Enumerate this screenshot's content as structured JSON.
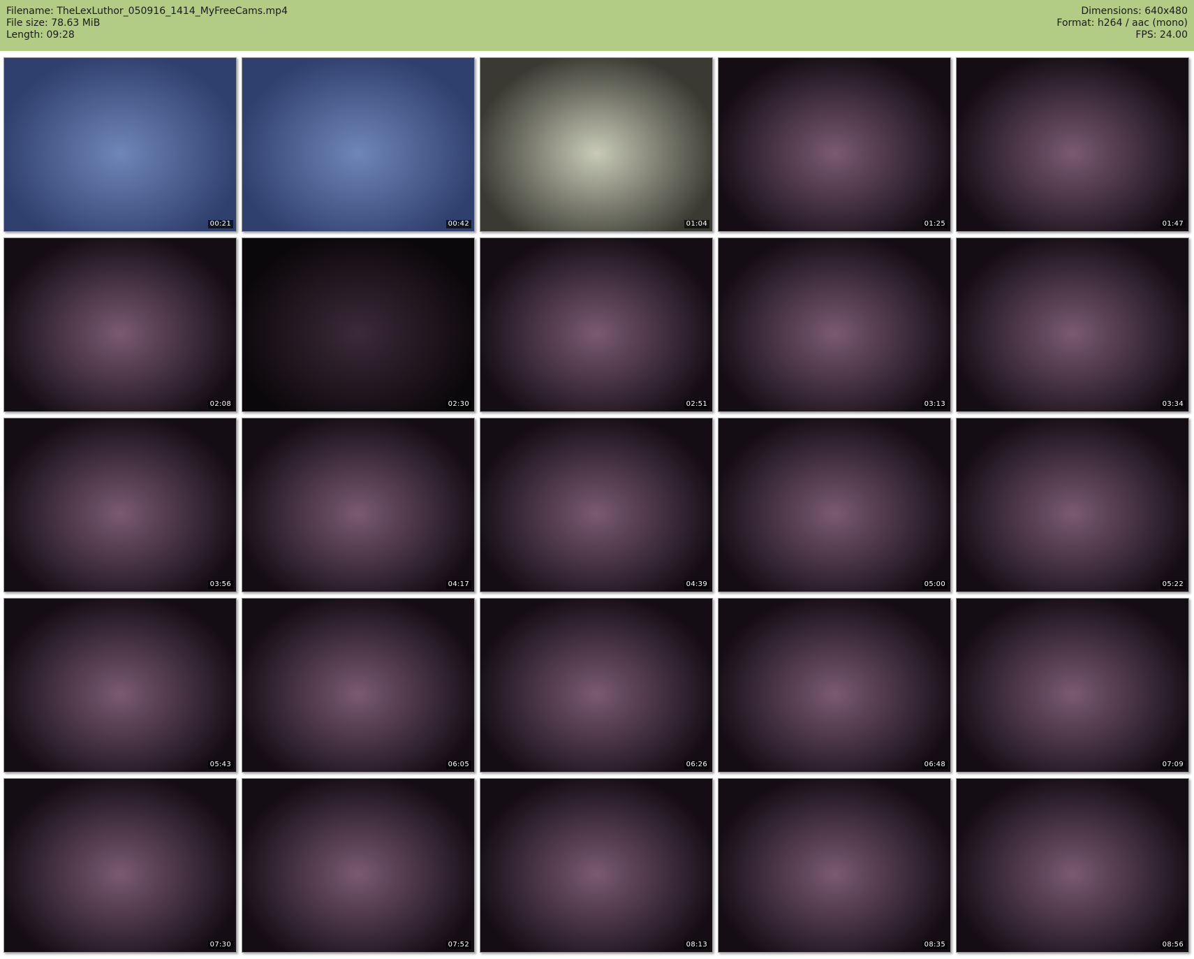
{
  "header": {
    "left": [
      {
        "label": "Filename:",
        "value": "TheLexLuthor_050916_1414_MyFreeCams.mp4"
      },
      {
        "label": "File size:",
        "value": "78.63 MiB"
      },
      {
        "label": "Length:",
        "value": "09:28"
      }
    ],
    "right": [
      {
        "label": "Dimensions:",
        "value": "640x480"
      },
      {
        "label": "Format:",
        "value": "h264 / aac (mono)"
      },
      {
        "label": "FPS:",
        "value": "24.00"
      }
    ]
  },
  "thumbnails": [
    {
      "timestamp": "00:21",
      "scene": "kitchen-blue"
    },
    {
      "timestamp": "00:42",
      "scene": "kitchen-blue"
    },
    {
      "timestamp": "01:04",
      "scene": "kitchen-empty"
    },
    {
      "timestamp": "01:25",
      "scene": "dark-room"
    },
    {
      "timestamp": "01:47",
      "scene": "dark-room"
    },
    {
      "timestamp": "02:08",
      "scene": "dark-room"
    },
    {
      "timestamp": "02:30",
      "scene": "dark-room-dim"
    },
    {
      "timestamp": "02:51",
      "scene": "dark-room"
    },
    {
      "timestamp": "03:13",
      "scene": "dark-room"
    },
    {
      "timestamp": "03:34",
      "scene": "dark-room"
    },
    {
      "timestamp": "03:56",
      "scene": "dark-room"
    },
    {
      "timestamp": "04:17",
      "scene": "dark-room"
    },
    {
      "timestamp": "04:39",
      "scene": "dark-room"
    },
    {
      "timestamp": "05:00",
      "scene": "dark-room"
    },
    {
      "timestamp": "05:22",
      "scene": "dark-room"
    },
    {
      "timestamp": "05:43",
      "scene": "dark-room"
    },
    {
      "timestamp": "06:05",
      "scene": "dark-room"
    },
    {
      "timestamp": "06:26",
      "scene": "dark-room"
    },
    {
      "timestamp": "06:48",
      "scene": "dark-room"
    },
    {
      "timestamp": "07:09",
      "scene": "dark-room"
    },
    {
      "timestamp": "07:30",
      "scene": "dark-room"
    },
    {
      "timestamp": "07:52",
      "scene": "dark-room"
    },
    {
      "timestamp": "08:13",
      "scene": "dark-room"
    },
    {
      "timestamp": "08:35",
      "scene": "dark-room"
    },
    {
      "timestamp": "08:56",
      "scene": "dark-room"
    }
  ],
  "colors": {
    "header_bg": "#b2cc85",
    "page_bg": "#ffffff",
    "scene": {
      "kitchen-blue": [
        "#6f86b8",
        "#2f3f6e"
      ],
      "kitchen-empty": [
        "#c9cbb8",
        "#3a3a32"
      ],
      "dark-room": [
        "#7a5a72",
        "#140d14"
      ],
      "dark-room-dim": [
        "#3c2a38",
        "#0b080b"
      ]
    }
  }
}
